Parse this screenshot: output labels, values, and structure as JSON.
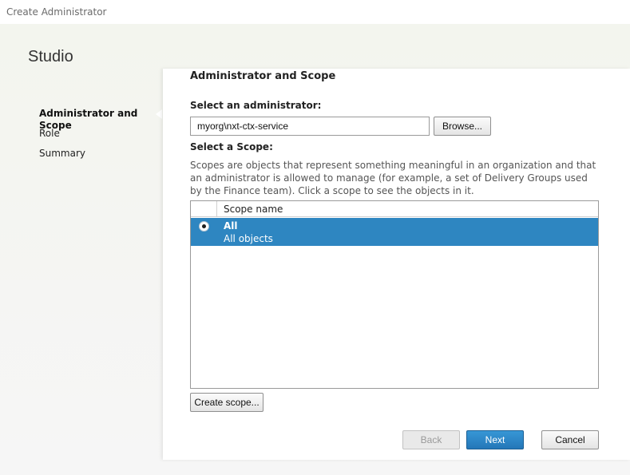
{
  "window": {
    "title": "Create Administrator"
  },
  "sidebar": {
    "title": "Studio",
    "items": [
      {
        "label": "Administrator and Scope",
        "active": true
      },
      {
        "label": "Role",
        "active": false
      },
      {
        "label": "Summary",
        "active": false
      }
    ]
  },
  "main": {
    "title": "Administrator and Scope",
    "select_admin_label": "Select an administrator:",
    "admin_value": "myorg\\nxt-ctx-service",
    "browse_label": "Browse...",
    "select_scope_label": "Select a Scope:",
    "scope_description": "Scopes are objects that represent something meaningful in an organization and that an administrator is allowed to manage (for example, a set of Delivery Groups used by the Finance team). Click a scope to see the objects in it.",
    "table": {
      "column_header": "Scope name",
      "rows": [
        {
          "name": "All",
          "description": "All objects",
          "selected": true
        }
      ]
    },
    "create_scope_label": "Create scope..."
  },
  "footer": {
    "back_label": "Back",
    "next_label": "Next",
    "cancel_label": "Cancel"
  },
  "colors": {
    "accent": "#2e86c1",
    "primary_button": "#2e86c1"
  }
}
